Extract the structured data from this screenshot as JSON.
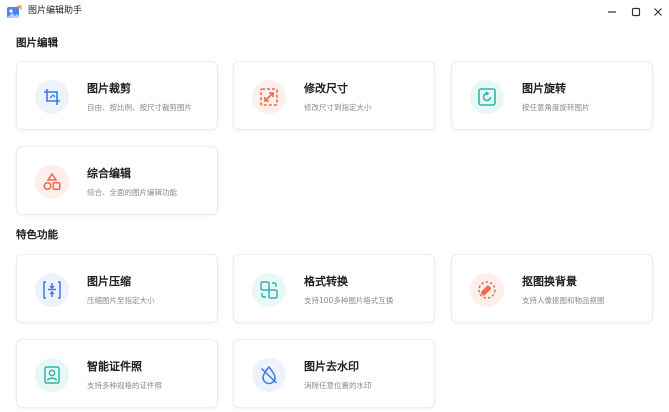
{
  "window": {
    "title": "图片编辑助手",
    "icon": "photo-app-icon",
    "controls": [
      "minimize-icon",
      "maximize-icon",
      "close-icon"
    ]
  },
  "sections": [
    {
      "title": "图片编辑",
      "cards": [
        {
          "title": "图片裁剪",
          "desc": "自由、按比例、按尺寸裁剪图片",
          "icon": "crop-icon",
          "bg": "#edf3fd",
          "color": "#3b7bea"
        },
        {
          "title": "修改尺寸",
          "desc": "修改尺寸到指定大小",
          "icon": "resize-icon",
          "bg": "#fdf0ec",
          "color": "#ef6b48"
        },
        {
          "title": "图片旋转",
          "desc": "按任意角度旋转图片",
          "icon": "rotate-icon",
          "bg": "#e8f8f6",
          "color": "#2fb5a7"
        },
        {
          "title": "综合编辑",
          "desc": "综合、全面的图片编辑功能",
          "icon": "shapes-icon",
          "bg": "#fdf0ec",
          "color": "#ef6b48"
        }
      ]
    },
    {
      "title": "特色功能",
      "cards": [
        {
          "title": "图片压缩",
          "desc": "压缩图片至指定大小",
          "icon": "compress-icon",
          "bg": "#edf3fd",
          "color": "#3b7bea"
        },
        {
          "title": "格式转换",
          "desc": "支持100多种图片格式互换",
          "icon": "convert-icon",
          "bg": "#e8f8f6",
          "color": "#2fb5a7"
        },
        {
          "title": "抠图换背景",
          "desc": "支持人像抠图和物品抠图",
          "icon": "cutout-icon",
          "bg": "#fdf0ec",
          "color": "#ef6b48"
        },
        {
          "title": "智能证件照",
          "desc": "支持多种规格的证件照",
          "icon": "id-photo-icon",
          "bg": "#e8f8f6",
          "color": "#2fb5a7"
        },
        {
          "title": "图片去水印",
          "desc": "消除任意位置的水印",
          "icon": "watermark-remove-icon",
          "bg": "#edf3fd",
          "color": "#3b7bea"
        }
      ]
    }
  ]
}
